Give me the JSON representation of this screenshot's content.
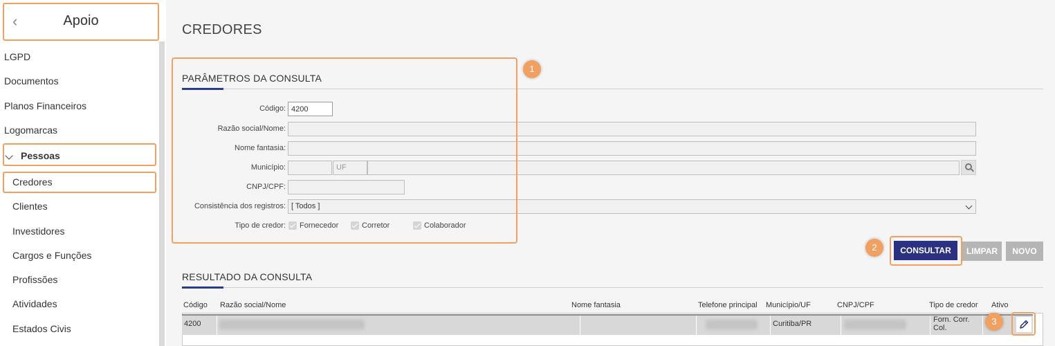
{
  "sidebar": {
    "title": "Apoio",
    "items": [
      "LGPD",
      "Documentos",
      "Planos Financeiros",
      "Logomarcas"
    ],
    "group": "Pessoas",
    "subitems": [
      "Credores",
      "Clientes",
      "Investidores",
      "Cargos e Funções",
      "Profissões",
      "Atividades",
      "Estados Civis"
    ]
  },
  "page": {
    "title": "CREDORES"
  },
  "params": {
    "title": "PARÂMETROS DA CONSULTA",
    "codigo_label": "Código:",
    "codigo_value": "4200",
    "razao_label": "Razão social/Nome:",
    "fantasia_label": "Nome fantasia:",
    "municipio_label": "Município:",
    "uf_placeholder": "UF",
    "cnpj_label": "CNPJ/CPF:",
    "consistencia_label": "Consistência dos registros:",
    "consistencia_value": "[ Todos ]",
    "tipo_label": "Tipo de credor:",
    "tipos": [
      "Fornecedor",
      "Corretor",
      "Colaborador"
    ]
  },
  "buttons": {
    "consultar": "CONSULTAR",
    "limpar": "LIMPAR",
    "novo": "NOVO"
  },
  "results": {
    "title": "RESULTADO DA CONSULTA",
    "columns": [
      "Código",
      "Razão social/Nome",
      "Nome fantasia",
      "Telefone principal",
      "Município/UF",
      "CNPJ/CPF",
      "Tipo de credor",
      "Ativo"
    ],
    "rows": [
      {
        "codigo": "4200",
        "municipio": "Curitiba/PR",
        "tipo": "Forn. Corr. Col."
      }
    ]
  },
  "badges": [
    "1",
    "2",
    "3"
  ],
  "colors": {
    "accent": "#2a3180",
    "highlight": "#f0a060"
  }
}
